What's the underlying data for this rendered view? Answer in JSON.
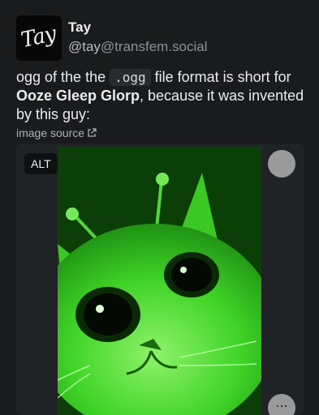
{
  "author": {
    "avatar_text": "Tay",
    "name": "Tay",
    "handle_user": "@tay",
    "handle_host": "@transfem.social"
  },
  "post": {
    "text_part1": "ogg of the the ",
    "code": ".ogg",
    "text_part2": " file format is short for ",
    "bold": "Ooze Gleep Glorp",
    "text_part3": ", because it was invented by this guy:",
    "source_link": "image source"
  },
  "media": {
    "alt_label": "ALT",
    "more_label": "..."
  }
}
